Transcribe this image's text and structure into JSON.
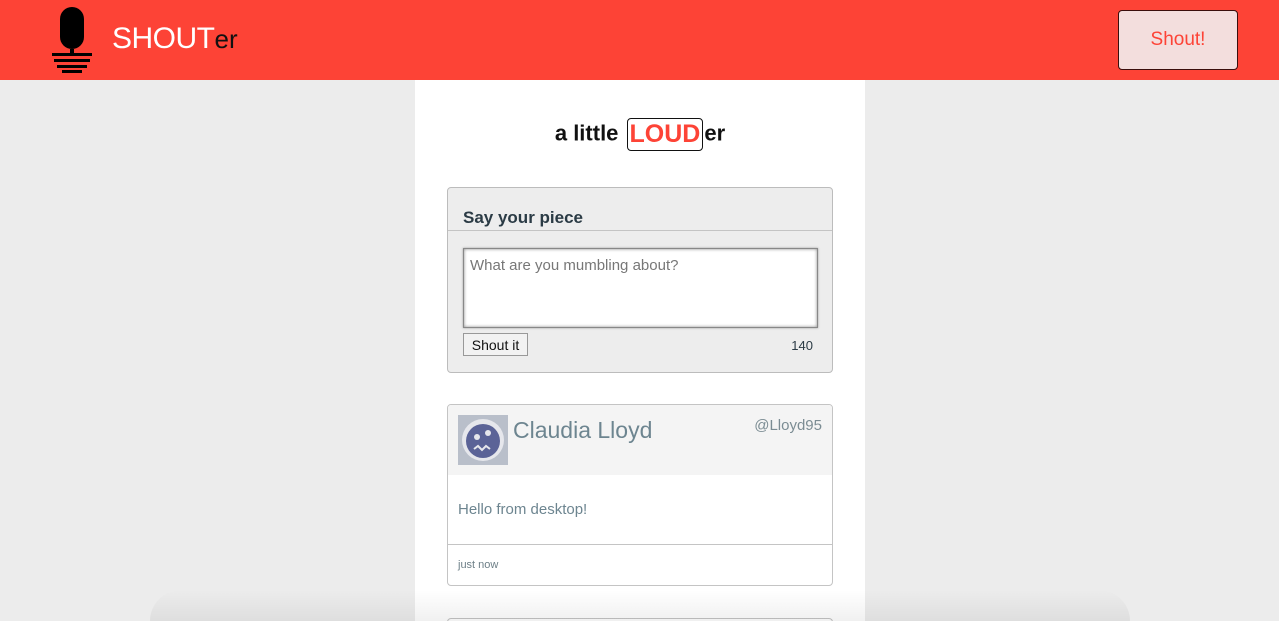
{
  "colors": {
    "accent": "#fd4336",
    "text_dark": "#2b3b45",
    "muted": "#6d8590"
  },
  "header": {
    "logo_icon": "microphone-icon",
    "brand_main": "SHOUT",
    "brand_suffix": "er",
    "shout_button": "Shout!"
  },
  "tagline": {
    "prefix": "a little ",
    "highlight": "LOUD",
    "suffix": "er"
  },
  "compose": {
    "title": "Say your piece",
    "placeholder": "What are you mumbling about?",
    "value": "",
    "submit_label": "Shout it",
    "char_count": "140"
  },
  "posts": [
    {
      "avatar_icon": "robot-avatar-icon",
      "name": "Claudia Lloyd",
      "handle": "@Lloyd95",
      "body": "Hello from desktop!",
      "time": "just now"
    }
  ]
}
